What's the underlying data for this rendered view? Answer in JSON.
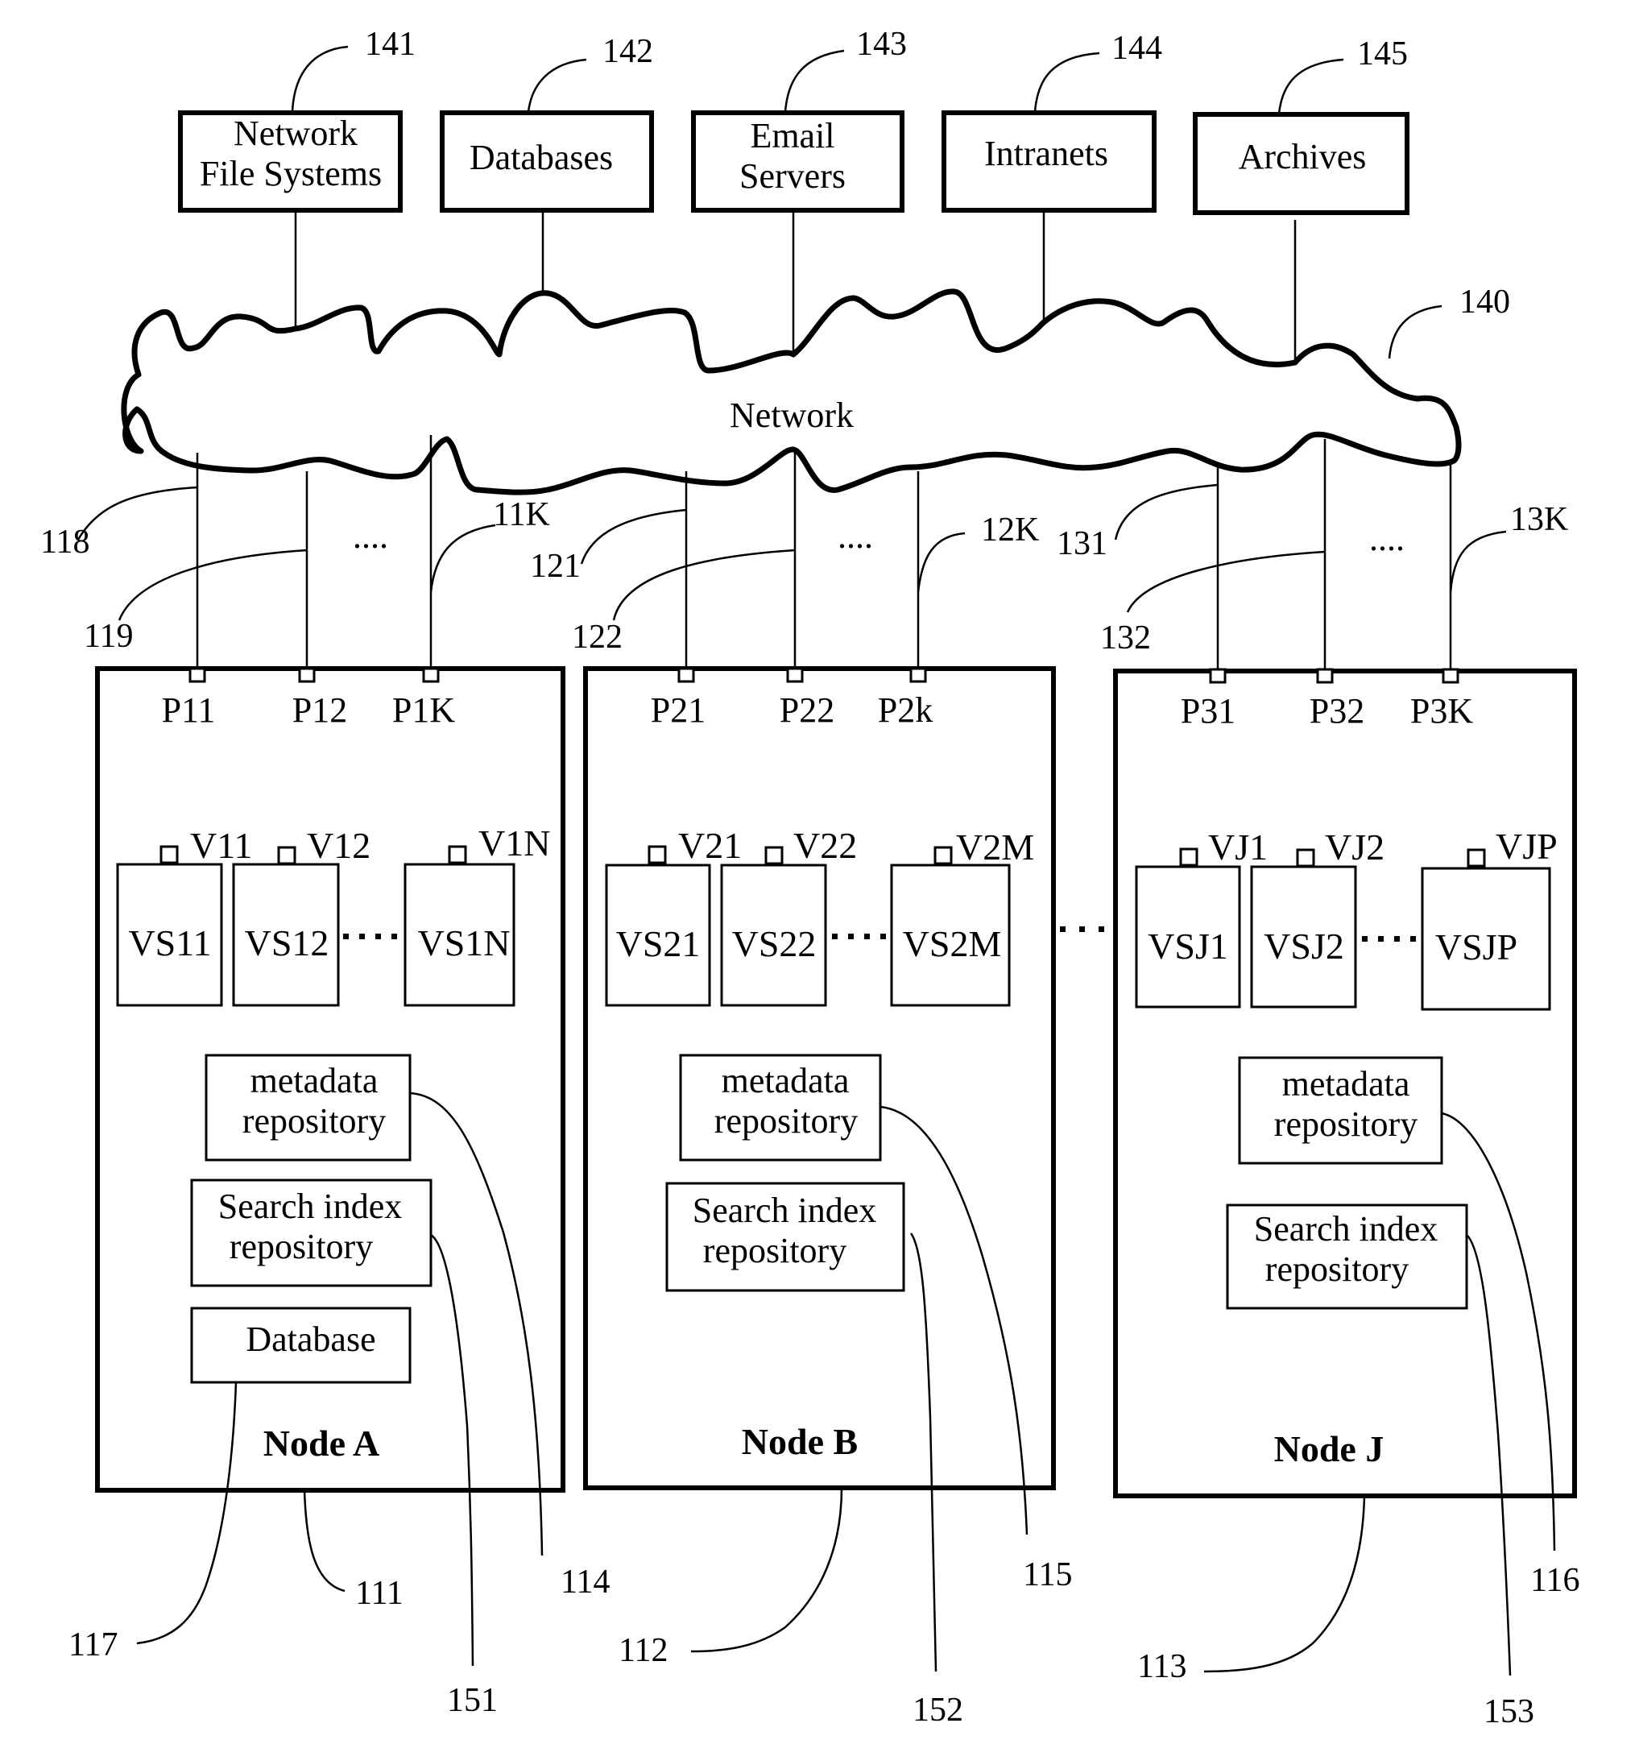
{
  "figure": {
    "sources": [
      {
        "ref": "141",
        "lines": [
          "Network",
          "File Systems"
        ]
      },
      {
        "ref": "142",
        "lines": [
          "Databases"
        ]
      },
      {
        "ref": "143",
        "lines": [
          "Email",
          "Servers"
        ]
      },
      {
        "ref": "144",
        "lines": [
          "Intranets"
        ]
      },
      {
        "ref": "145",
        "lines": [
          "Archives"
        ]
      }
    ],
    "network": {
      "label": "Network",
      "ref": "140"
    },
    "link_refs": {
      "node_a": [
        "118",
        "119",
        "11K"
      ],
      "node_b": [
        "121",
        "122",
        "12K"
      ],
      "node_j": [
        "131",
        "132",
        "13K"
      ]
    },
    "ellipsis": "....",
    "nodes": [
      {
        "name": "Node A",
        "ref": "111",
        "ports": [
          "P11",
          "P12",
          "P1K"
        ],
        "vs_ports": [
          "V11",
          "V12",
          "V1N"
        ],
        "vs": [
          "VS11",
          "VS12",
          "VS1N"
        ],
        "metadata": {
          "lines": [
            "metadata",
            "repository"
          ],
          "ref": "114"
        },
        "search": {
          "lines": [
            "Search index",
            "repository"
          ],
          "ref": "151"
        },
        "database": {
          "label": "Database",
          "ref": "117"
        }
      },
      {
        "name": "Node B",
        "ref": "112",
        "ports": [
          "P21",
          "P22",
          "P2k"
        ],
        "vs_ports": [
          "V21",
          "V22",
          "V2M"
        ],
        "vs": [
          "VS21",
          "VS22",
          "VS2M"
        ],
        "metadata": {
          "lines": [
            "metadata",
            "repository"
          ],
          "ref": "115"
        },
        "search": {
          "lines": [
            "Search index",
            "repository"
          ],
          "ref": "152"
        }
      },
      {
        "name": "Node J",
        "ref": "113",
        "ports": [
          "P31",
          "P32",
          "P3K"
        ],
        "vs_ports": [
          "VJ1",
          "VJ2",
          "VJP"
        ],
        "vs": [
          "VSJ1",
          "VSJ2",
          "VSJP"
        ],
        "metadata": {
          "lines": [
            "metadata",
            "repository"
          ],
          "ref": "116"
        },
        "search": {
          "lines": [
            "Search index",
            "repository"
          ],
          "ref": "153"
        }
      }
    ]
  }
}
